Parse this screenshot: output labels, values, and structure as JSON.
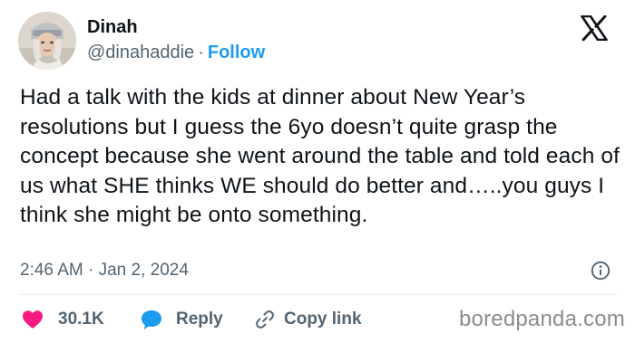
{
  "author": {
    "name": "Dinah",
    "handle": "@dinahaddie",
    "separator": "·",
    "follow_label": "Follow"
  },
  "tweet": {
    "text": "Had a talk with the kids at dinner about New Year’s resolutions but I guess the 6yo doesn’t quite grasp the concept because she went around the table and told each of us what SHE thinks WE should do better and…..you guys I think she might be onto something.",
    "timestamp": "2:46 AM · Jan 2, 2024"
  },
  "actions": {
    "like_count": "30.1K",
    "reply_label": "Reply",
    "copy_label": "Copy link"
  },
  "icons": {
    "brand": "x-logo-icon",
    "info": "info-icon",
    "like": "heart-icon",
    "reply": "speech-bubble-icon",
    "copy": "link-icon"
  },
  "colors": {
    "accent": "#1d9bf0",
    "like": "#f91880",
    "muted": "#536471",
    "text": "#0f1419"
  },
  "watermark": "boredpanda.com"
}
